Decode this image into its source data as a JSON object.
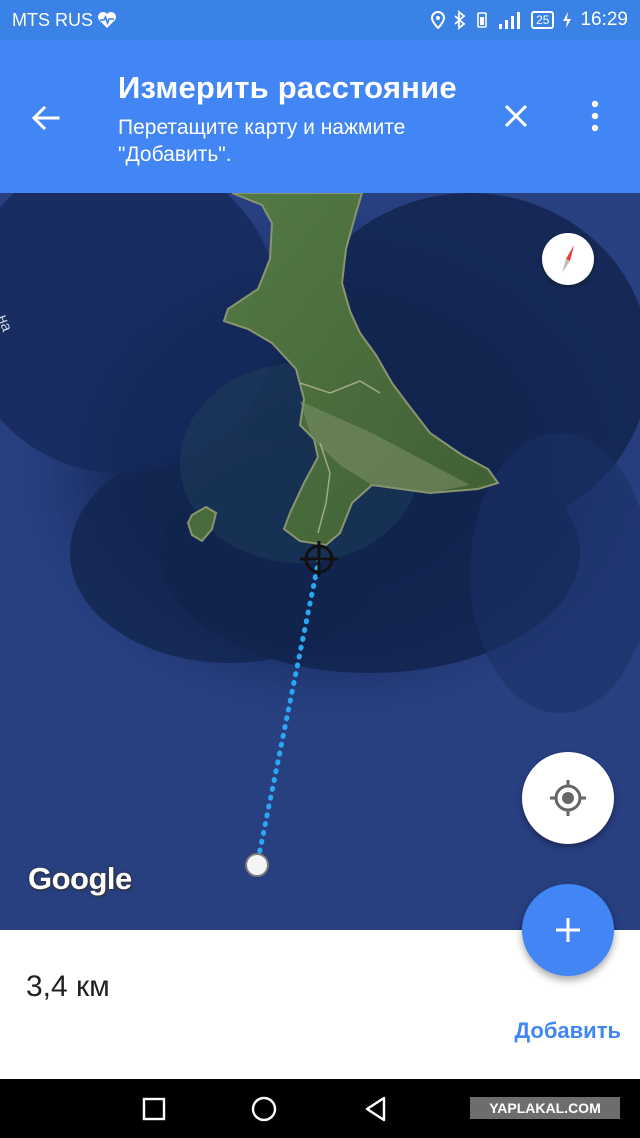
{
  "status_bar": {
    "carrier": "MTS RUS",
    "battery": "25",
    "time": "16:29"
  },
  "app_bar": {
    "title": "Измерить расстояние",
    "subtitle": "Перетащите карту и нажмите \"Добавить\"."
  },
  "map": {
    "logo": "Google",
    "edge_label": "на"
  },
  "bottom": {
    "distance": "3,4 км",
    "add_label": "Добавить"
  },
  "watermark": "YAPLAKAL.COM",
  "colors": {
    "primary": "#4285f4",
    "status_bar": "#3b82e6",
    "measure_line": "#29a8f4",
    "sea": "#253b7a",
    "land": "#4f6e3f"
  },
  "icons": [
    "heart-monitor-icon",
    "location-icon",
    "bluetooth-icon",
    "signal-icon",
    "charging-icon",
    "back-arrow-icon",
    "close-icon",
    "more-vert-icon",
    "compass-icon",
    "my-location-icon",
    "plus-icon",
    "crosshair-icon",
    "square-nav-icon",
    "home-nav-icon",
    "back-nav-icon",
    "notification-down-icon"
  ]
}
